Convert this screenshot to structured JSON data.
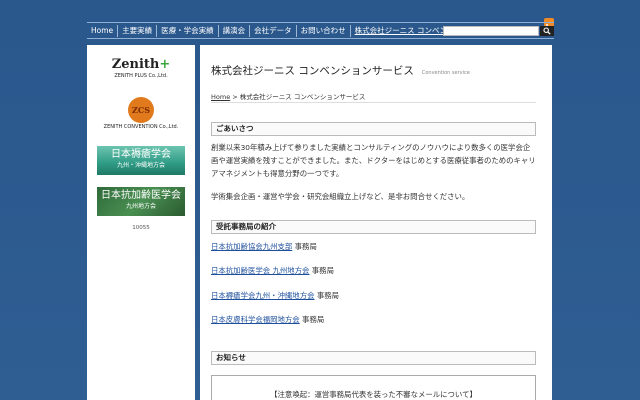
{
  "header": {
    "rss_icon": "rss-icon",
    "nav": [
      {
        "label": "Home"
      },
      {
        "label": "主要実績"
      },
      {
        "label": "医療・学会実績"
      },
      {
        "label": "講演会"
      },
      {
        "label": "会社データ"
      },
      {
        "label": "お問い合わせ"
      },
      {
        "label": "株式会社ジーニス コンベンションサービス"
      }
    ],
    "search": {
      "placeholder": "",
      "button_icon": "search-icon"
    }
  },
  "sidebar": {
    "zenith_plus": {
      "title": "Zenith",
      "plus": "+",
      "sub": "ZENITH PLUS Co.,Ltd."
    },
    "zcs": {
      "mark": "ZCS",
      "sub": "ZENITH CONVENTION Co.,Ltd."
    },
    "banner1": {
      "main": "日本褥瘡学会",
      "sub": "九州・沖縄地方会"
    },
    "banner2": {
      "main": "日本抗加齢医学会",
      "sub": "九州地方会"
    },
    "counter": "10055"
  },
  "main": {
    "title": "株式会社ジーニス コンベンションサービス",
    "subtitle": "Convention service",
    "breadcrumb": {
      "home": "Home",
      "sep": " > ",
      "current": "株式会社ジーニス コンベンションサービス"
    },
    "greeting": {
      "heading": "ごあいさつ",
      "para1": "創業以来30年積み上げて参りました実績とコンサルティングのノウハウにより数多くの医学会企画や運営実績を残すことができました。また、ドクターをはじめとする医療従事者のためのキャリアマネジメントも得意分野の一つです。",
      "para2": "学術集会企画・運営や学会・研究会組織立上げなど、是非お問合せください。"
    },
    "offices": {
      "heading": "受託事務局の紹介",
      "items": [
        {
          "link": "日本抗加齢協会九州支部",
          "suffix": " 事務局"
        },
        {
          "link": "日本抗加齢医学会 九州地方会",
          "suffix": " 事務局"
        },
        {
          "link": "日本褥瘡学会九州・沖縄地方会",
          "suffix": " 事務局"
        },
        {
          "link": "日本皮膚科学会福岡地方会",
          "suffix": " 事務局"
        }
      ]
    },
    "news": {
      "heading": "お知らせ",
      "notice": "【注意喚起：運営事務局代表を装った不審なメールについて】"
    }
  },
  "colors": {
    "background": "#2d5a8e",
    "link": "#1d4f9c",
    "rss": "#f08a24",
    "zenith_plus": "#3aa53a",
    "zcs_logo": "#e07a1c"
  }
}
